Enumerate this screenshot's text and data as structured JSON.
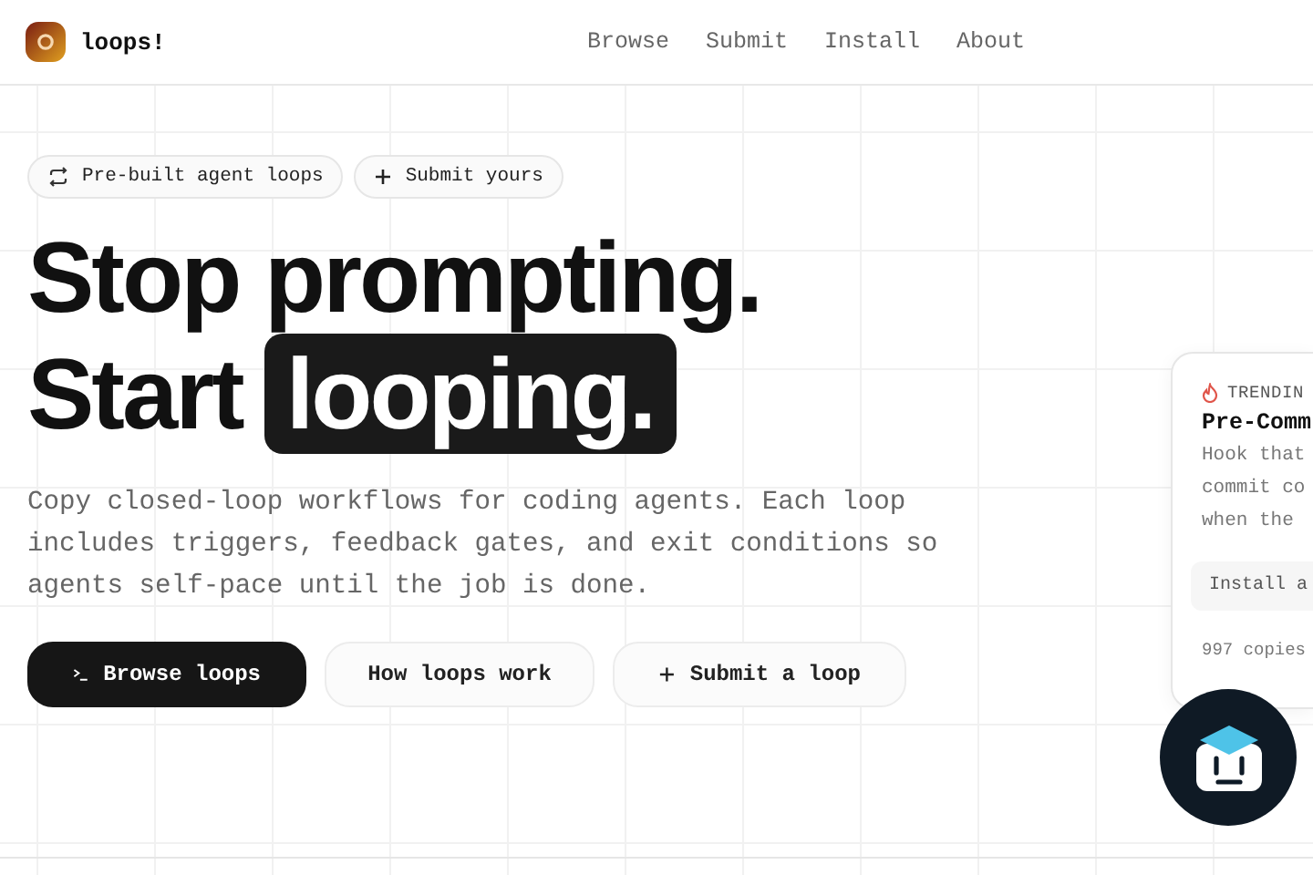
{
  "header": {
    "brand": "loops!",
    "nav": [
      {
        "label": "Browse"
      },
      {
        "label": "Submit"
      },
      {
        "label": "Install"
      },
      {
        "label": "About"
      }
    ]
  },
  "pills": [
    {
      "kind": "loop",
      "label": "Pre-built agent loops"
    },
    {
      "kind": "plus",
      "label": "Submit yours"
    }
  ],
  "headline": {
    "line_1": "Stop prompting.",
    "line_2": "Start",
    "highlight": "looping."
  },
  "intro": "Copy closed-loop workflows for coding agents. Each loop includes triggers, feedback gates, and exit conditions so agents self-pace until the job is done.",
  "actions": [
    {
      "kind": "primary",
      "label": "Browse loops"
    },
    {
      "kind": "plain",
      "label": "How loops work"
    },
    {
      "kind": "plus",
      "label": "Submit a loop"
    }
  ],
  "trending_card": {
    "tag": "TRENDIN",
    "title": "Pre-Comm",
    "description": [
      "Hook that",
      "commit co",
      "when the"
    ],
    "install": "Install a",
    "copies": "997 copies"
  }
}
